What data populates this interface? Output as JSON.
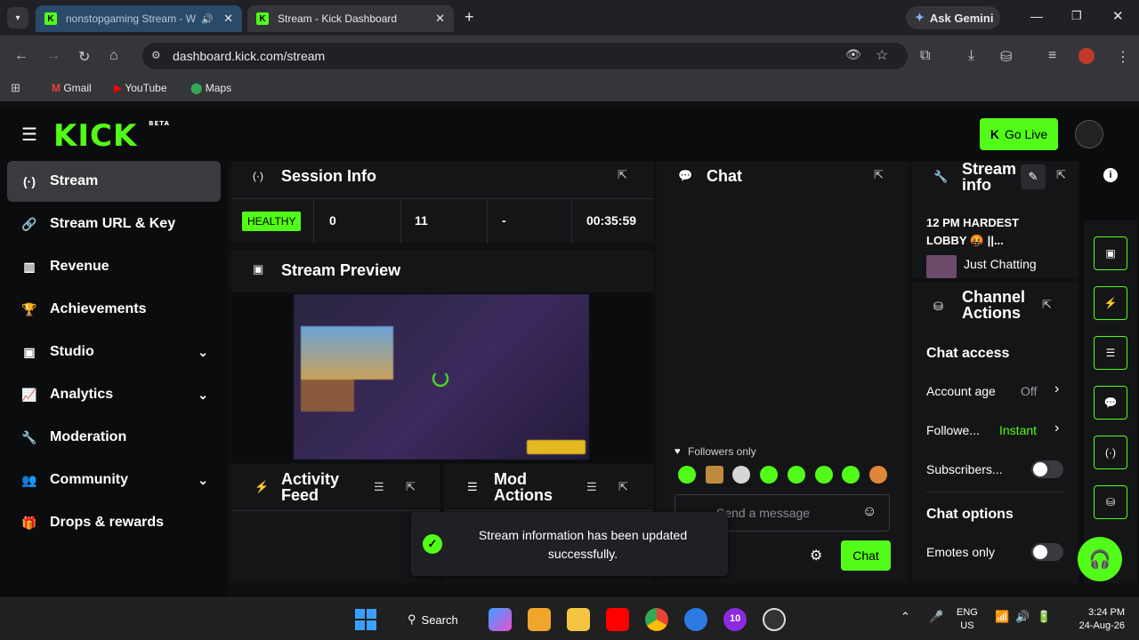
{
  "browser": {
    "tabs": [
      {
        "title": "nonstopgaming Stream - W"
      },
      {
        "title": "Stream - Kick Dashboard"
      }
    ],
    "new_tab": "+",
    "ask_gemini": "Ask Gemini",
    "url": "dashboard.kick.com/stream",
    "bookmarks": [
      "Gmail",
      "YouTube",
      "Maps"
    ]
  },
  "app": {
    "logo": "KICK",
    "logo_badge": "BETA",
    "go_live": "Go Live"
  },
  "sidebar": {
    "items": [
      {
        "label": "Stream",
        "icon": "broadcast-icon",
        "active": true
      },
      {
        "label": "Stream URL & Key",
        "icon": "link-icon"
      },
      {
        "label": "Revenue",
        "icon": "chart-icon"
      },
      {
        "label": "Achievements",
        "icon": "trophy-icon"
      },
      {
        "label": "Studio",
        "icon": "studio-icon",
        "expandable": true
      },
      {
        "label": "Analytics",
        "icon": "analytics-icon",
        "expandable": true
      },
      {
        "label": "Moderation",
        "icon": "wrench-icon"
      },
      {
        "label": "Community",
        "icon": "people-icon",
        "expandable": true
      },
      {
        "label": "Drops & rewards",
        "icon": "gift-icon"
      }
    ]
  },
  "session": {
    "title": "Session Info",
    "status": "HEALTHY",
    "stats": [
      "0",
      "11",
      "-",
      "00:35:59"
    ]
  },
  "preview": {
    "title": "Stream Preview"
  },
  "activity": {
    "title_line1": "Activity",
    "title_line2": "Feed"
  },
  "mod": {
    "title_line1": "Mod",
    "title_line2": "Actions"
  },
  "chat": {
    "title": "Chat",
    "followers_only": "Followers only",
    "placeholder": "Send a message",
    "send": "Chat"
  },
  "stream_info": {
    "title_line1": "Stream",
    "title_line2": "info",
    "stream_title": "12 PM HARDEST LOBBY 🤬 ||...",
    "category": "Just Chatting"
  },
  "channel_actions": {
    "title_line1": "Channel",
    "title_line2": "Actions",
    "chat_access": "Chat access",
    "account_age": "Account age",
    "account_age_value": "Off",
    "followers": "Followe...",
    "followers_value": "Instant",
    "subscribers": "Subscribers...",
    "chat_options": "Chat options",
    "emotes_only": "Emotes only"
  },
  "toast": {
    "message": "Stream information has been updated successfully."
  },
  "taskbar": {
    "search": "Search",
    "lang1": "ENG",
    "lang2": "US",
    "time": "3:24 PM",
    "date": "24-Aug-26",
    "badge": "10"
  },
  "colors": {
    "accent": "#53fc18",
    "panel": "#141517",
    "bg": "#0f1011"
  }
}
